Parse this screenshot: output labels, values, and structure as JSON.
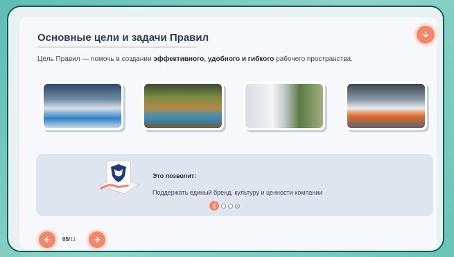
{
  "slide": {
    "title": "Основные цели и задачи Правил",
    "description_prefix": "Цель Правил — помочь в создании ",
    "description_bold": "эффективного, удобного и гибкого",
    "description_suffix": " рабочего пространства."
  },
  "photos": [
    {
      "icon": "office-lobby-photo"
    },
    {
      "icon": "lounge-area-photo"
    },
    {
      "icon": "corridor-photo"
    },
    {
      "icon": "meeting-room-photo"
    }
  ],
  "info_panel": {
    "heading": "Это позволит:",
    "text": "Поддержать единый бренд, культуру и ценности компании",
    "dots_total": 4,
    "dots_current": 1
  },
  "pagination": {
    "current": "05",
    "total": "11"
  },
  "colors": {
    "accent": "#f5866a",
    "frame_border": "#0f5f55",
    "background": "#5dbdb3"
  }
}
